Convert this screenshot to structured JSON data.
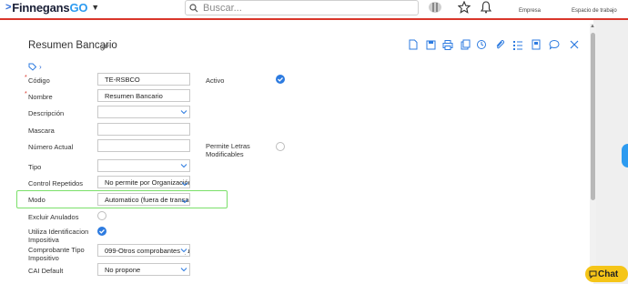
{
  "brand": {
    "name": "Finnegans",
    "suffix": "GO"
  },
  "search": {
    "placeholder": "Buscar..."
  },
  "header": {
    "empresa_label": "Empresa",
    "espacio_label": "Espacio de trabajo"
  },
  "page": {
    "title": "Resumen Bancario"
  },
  "form": {
    "codigo": {
      "label": "Código",
      "value": "TE-RSBCO"
    },
    "nombre": {
      "label": "Nombre",
      "value": "Resumen Bancario"
    },
    "descripcion": {
      "label": "Descripción",
      "value": ""
    },
    "mascara": {
      "label": "Mascara",
      "value": ""
    },
    "numero_actual": {
      "label": "Número Actual",
      "value": ""
    },
    "tipo": {
      "label": "Tipo",
      "value": ""
    },
    "control_repetidos": {
      "label": "Control Repetidos",
      "value": "No permite por Organización"
    },
    "modo": {
      "label": "Modo",
      "value": "Automatico (fuera de transacc..."
    },
    "excluir_anulados": {
      "label": "Excluir Anulados",
      "checked": false
    },
    "utiliza_identificacion": {
      "label_1": "Utiliza Identificacion",
      "label_2": "Impositiva",
      "checked": true
    },
    "comprobante_tipo": {
      "label_1": "Comprobante Tipo",
      "label_2": "Impositivo",
      "value": "099-Otros comprobantes qu"
    },
    "cai_default": {
      "label": "CAI Default",
      "value": "No propone"
    },
    "activo": {
      "label": "Activo",
      "checked": true
    },
    "permite_letras": {
      "label_1": "Permite Letras",
      "label_2": "Modificables",
      "checked": false
    }
  },
  "chat": {
    "label": "Chat"
  },
  "colors": {
    "accent": "#2d7be0",
    "top_border": "#d9362b",
    "highlight": "#7be06a",
    "chat": "#f5c518"
  }
}
